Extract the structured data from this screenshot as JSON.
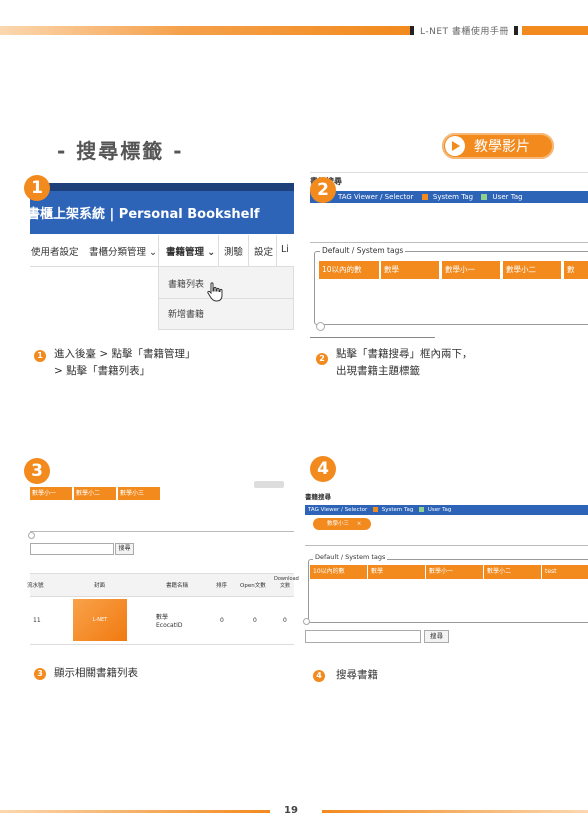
{
  "header": {
    "title": "L-NET 書櫃使用手冊"
  },
  "section": {
    "title": "- 搜尋標籤 -"
  },
  "video_button": {
    "label": "教學影片"
  },
  "steps": [
    {
      "number": "1",
      "caption_line1": "進入後臺 > 點擊「書籍管理」",
      "caption_line2": "> 點擊「書籍列表」"
    },
    {
      "number": "2",
      "caption_line1": "點擊「書籍搜尋」框內兩下，",
      "caption_line2": "出現書籍主題標籤"
    },
    {
      "number": "3",
      "caption_line1": "顯示相關書籍列表"
    },
    {
      "number": "4",
      "caption_line1": "搜尋書籍"
    }
  ],
  "shot1": {
    "app_title": "書櫃上架系統 | Personal Bookshelf",
    "menu": [
      "使用者設定",
      "書櫃分類管理 ⌄",
      "書籍管理 ⌄",
      "測驗",
      "設定",
      "Li"
    ],
    "dropdown": [
      "書籍列表",
      "新增書籍"
    ]
  },
  "shot2": {
    "heading": "書籍搜尋",
    "tag_viewer": "TAG Viewer / Selector",
    "system_tag": "System Tag",
    "user_tag": "User Tag",
    "fieldset_label": "Default / System tags",
    "tags": [
      "10以內的數",
      "數學",
      "數學小一",
      "數學小二",
      "數"
    ]
  },
  "shot3": {
    "tags": [
      "數學小一",
      "數學小二",
      "數學小三"
    ],
    "search_button": "搜尋",
    "table_headers": [
      "流水號",
      "封面",
      "書籍名稱",
      "排序",
      "Open文數",
      "Download 文數"
    ],
    "row": {
      "id": "11",
      "cover": "L-NET",
      "name_line1": "數學",
      "name_line2": "EcocatID",
      "sort": "0",
      "open": "0",
      "download": "0"
    }
  },
  "shot4": {
    "heading": "書籍搜尋",
    "tag_viewer": "TAG Viewer / Selector",
    "system_tag": "System Tag",
    "user_tag": "User Tag",
    "selected_tag": "數學小三",
    "fieldset_label": "Default / System tags",
    "tags": [
      "10以內的數",
      "數學",
      "數學小一",
      "數學小二",
      "test"
    ],
    "search_button": "搜尋"
  },
  "footer": {
    "page_number": "19"
  },
  "colors": {
    "accent": "#f28a1e",
    "blue": "#2e64b8",
    "navy": "#1d3f7a"
  }
}
